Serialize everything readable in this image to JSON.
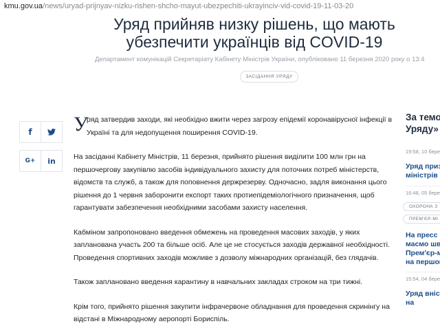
{
  "url": {
    "domain": "kmu.gov.ua",
    "path": "/news/uryad-prijnyav-nizku-rishen-shcho-mayut-ubezpechiti-ukrayinciv-vid-covid-19-11-03-20"
  },
  "article": {
    "title_line1": "Уряд прийняв низку рішень, що мають",
    "title_line2": "убезпечити українців від COVID-19",
    "byline": "Департамент комунікацій Секретаріату Кабінету Міністрів України, опубліковано 11 березня 2020 року о 13:4",
    "tag": "ЗАСІДАННЯ УРЯДУ",
    "dropcap": "У",
    "lead_rest": "ряд затвердив заходи, які необхідно вжити через загрозу епідемії коронавірусної інфекції в Україні  та для недопущення поширення COVID-19.",
    "p2": "На засіданні Кабінету Міністрів, 11 березня, прийнято рішення виділити 100 млн грн на першочергову закупівлю засобів індивідуального захисту для поточних потреб міністерств, відомств та служб, а також для поповнення держрезерву. Одночасно, задля виконання цього рішення до 1 червня заборонити експорт таких протиепідеміологічного призначення, щоб гарантувати забезпечення необхідними засобами захисту населення.",
    "p3": "Кабміном запропоновано введення обмежень на проведення масових заходів, у яких запланована участь 200 та більше осіб. Але це не стосується заходів державної необхідності. Проведення спортивних заходів можливе з дозволу міжнародних організацій, без глядачів.",
    "p4": "Також заплановано введення карантину в навчальних закладах строком на три тижні.",
    "p5": "Крім того, прийнято рішення закупити інфрачервоне обладнання  для проведення скринінгу на відстані в Міжнародному аеропорті Бориспіль."
  },
  "share": [
    {
      "icon": "facebook-icon",
      "glyph": "f"
    },
    {
      "icon": "twitter-icon",
      "glyph": "t"
    },
    {
      "icon": "google-plus-icon",
      "glyph": "G+"
    },
    {
      "icon": "linkedin-icon",
      "glyph": "in"
    }
  ],
  "sidebar": {
    "heading_line1": "За темо",
    "heading_line2": "Уряду»",
    "items": [
      {
        "date": "19:58, 10 берез",
        "link_line1": "Уряд призн",
        "link_line2": "міністрів"
      },
      {
        "date": "16:48, 05 берез",
        "pill1": "ОХОРОНА З",
        "pill2": "ПРЕМ'ЄР-МІ",
        "link_line1": "На пресс",
        "link_line2": "масмо швид",
        "link_line3": "Прем'єр-мі",
        "link_line4": "на першом"
      },
      {
        "date": "15:54, 04 берез",
        "link_line1": "Уряд вніс з",
        "link_line2": "на"
      }
    ]
  },
  "colors": {
    "title": "#1f2c3d",
    "link": "#1c4e8a",
    "muted": "#9aa1a8"
  }
}
